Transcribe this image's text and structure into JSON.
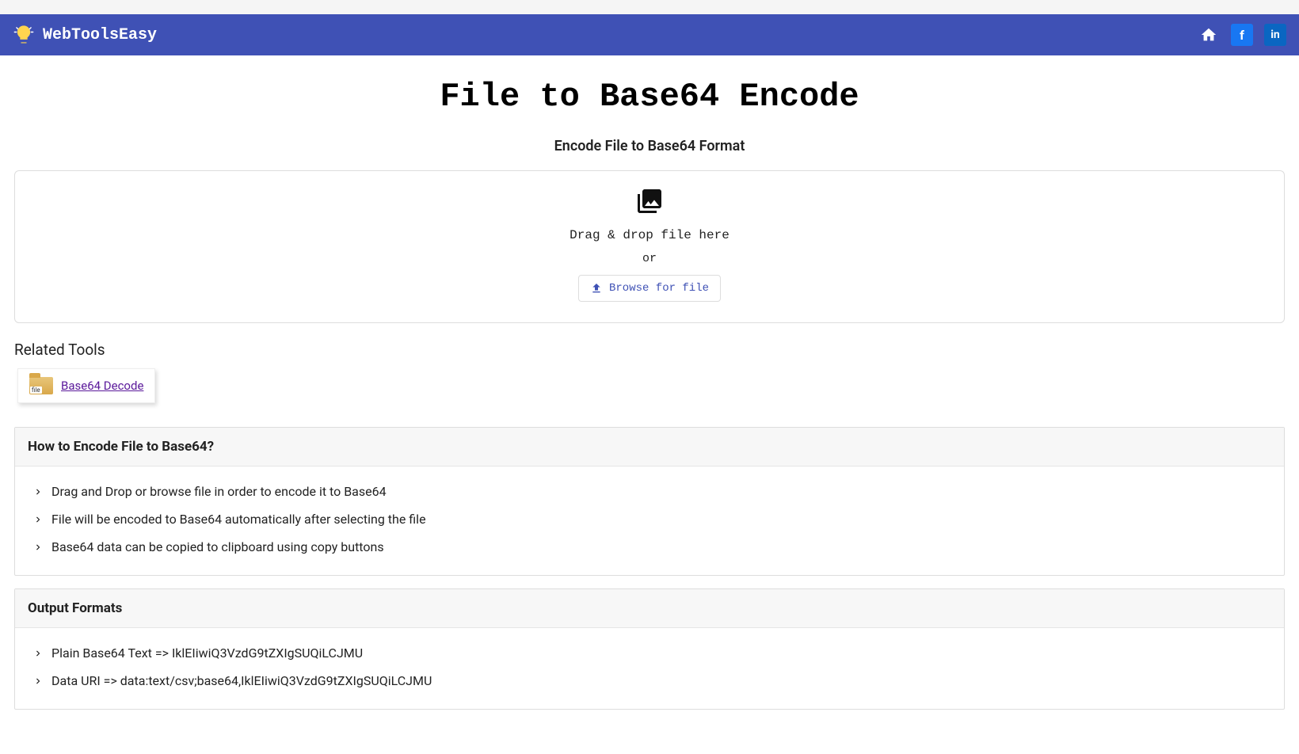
{
  "navbar": {
    "brand": "WebToolsEasy"
  },
  "page": {
    "title": "File to Base64 Encode",
    "subtitle": "Encode File to Base64 Format"
  },
  "dropzone": {
    "text": "Drag & drop file here",
    "or": "or",
    "browse_label": "Browse for file"
  },
  "related": {
    "heading": "Related Tools",
    "items": [
      {
        "label": "Base64 Decode"
      }
    ]
  },
  "howto": {
    "heading": "How to Encode File to Base64?",
    "steps": [
      "Drag and Drop or browse file in order to encode it to Base64",
      "File will be encoded to Base64 automatically after selecting the file",
      "Base64 data can be copied to clipboard using copy buttons"
    ]
  },
  "output": {
    "heading": "Output Formats",
    "items": [
      "Plain Base64 Text => IklEIiwiQ3VzdG9tZXIgSUQiLCJMU",
      "Data URI => data:text/csv;base64,IklEIiwiQ3VzdG9tZXIgSUQiLCJMU"
    ]
  }
}
